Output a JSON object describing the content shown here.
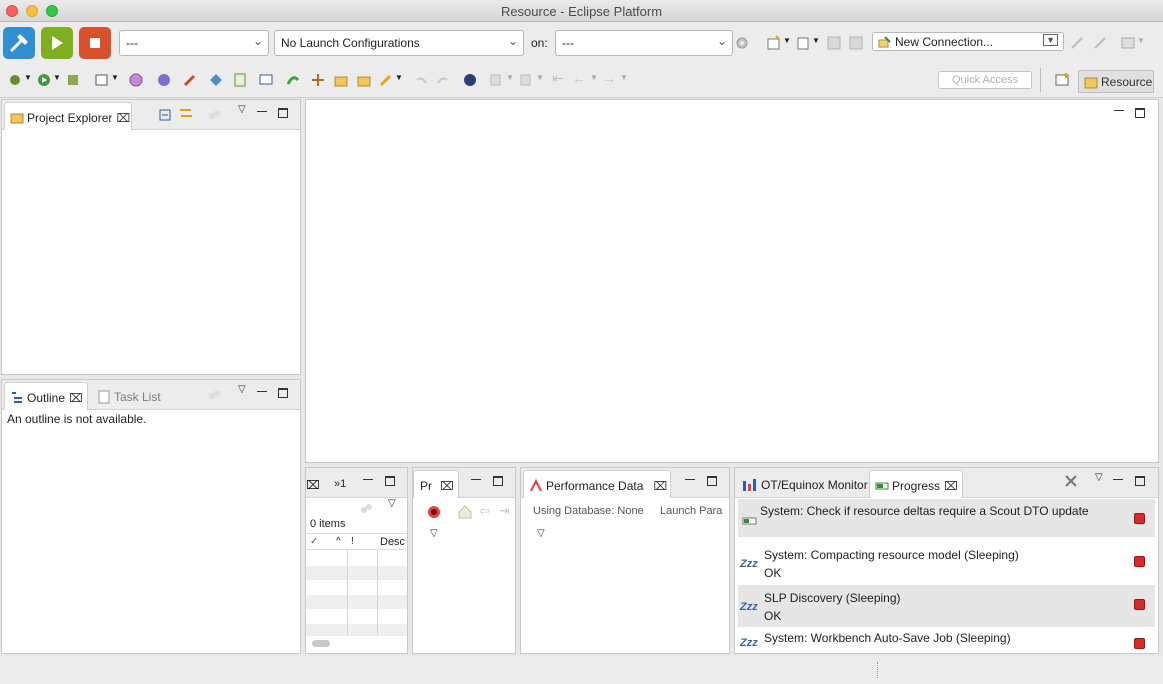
{
  "window": {
    "title": "Resource - Eclipse Platform"
  },
  "toolbar": {
    "launch_mode": "---",
    "launch_config": "No Launch Configurations",
    "on_label": "on:",
    "launch_target": "---",
    "connection": "New Connection...",
    "quick_access_placeholder": "Quick Access",
    "perspective": "Resource"
  },
  "project_explorer": {
    "tab": "Project Explorer"
  },
  "outline": {
    "tab": "Outline",
    "tab2": "Task List",
    "message": "An outline is not available."
  },
  "problems": {
    "tab_fragment": "»1",
    "items_count": "0 items",
    "col_check": "✓",
    "col_sort": "^",
    "col_bang": "!",
    "col_desc": "Desc"
  },
  "mini_view": {
    "tab": "Pr"
  },
  "performance": {
    "tab": "Performance Data",
    "db_text": "Using Database: None",
    "launch_text": "Launch Para"
  },
  "progress_view": {
    "tab_monitor": "OT/Equinox Monitor",
    "tab_progress": "Progress",
    "rows": [
      {
        "title": "System: Check if resource deltas require a Scout DTO update",
        "status": ""
      },
      {
        "title": "System: Compacting resource model (Sleeping)",
        "status": "OK"
      },
      {
        "title": "SLP Discovery (Sleeping)",
        "status": "OK"
      },
      {
        "title": "System: Workbench Auto-Save Job (Sleeping)",
        "status": ""
      }
    ],
    "sleep_icon_text": "Zzz"
  },
  "colors": {
    "accent_build": "#2f8fd1",
    "accent_run": "#7fae1f",
    "accent_stop": "#d9512c",
    "stop_red": "#d42c2c"
  }
}
